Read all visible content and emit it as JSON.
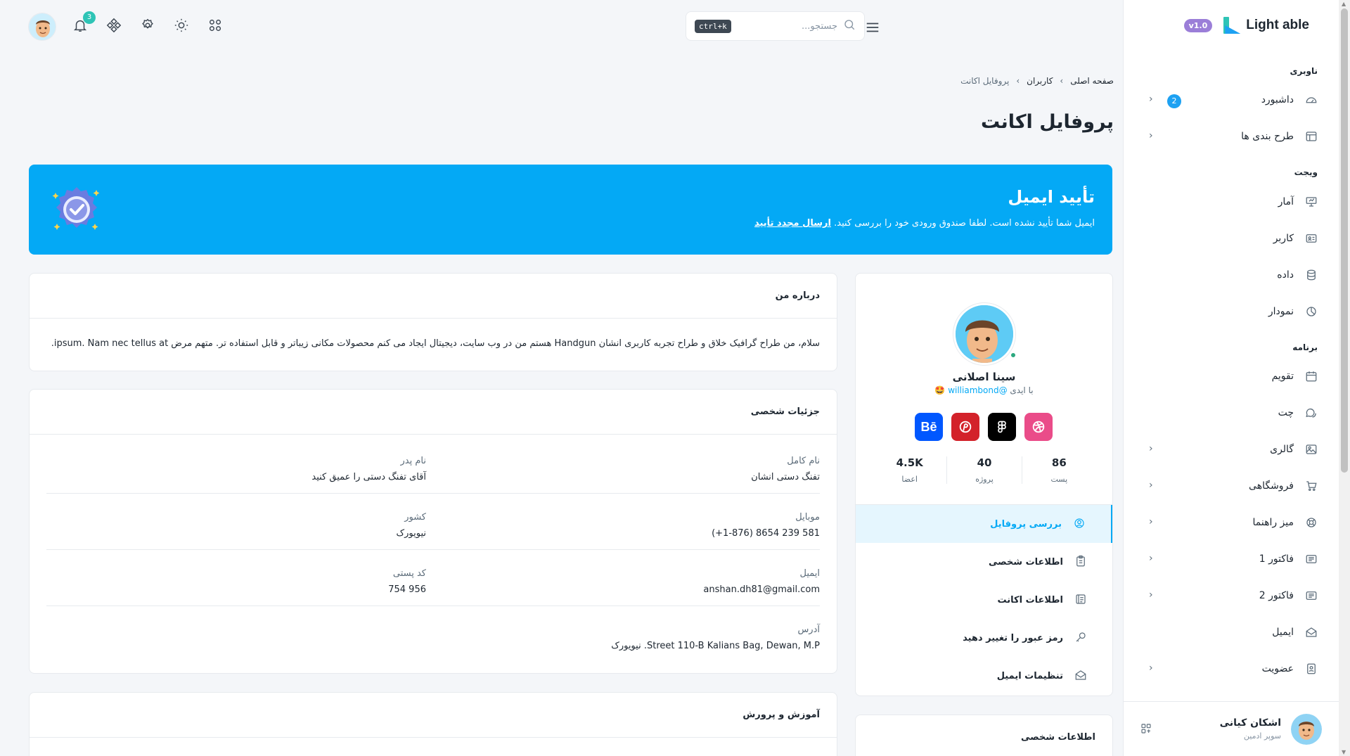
{
  "sidebar": {
    "brand": "Light able",
    "version": "v1.0",
    "sections": {
      "nav": "ناوبری",
      "widget": "ویجت",
      "app": "برنامه"
    },
    "items": [
      {
        "label": "داشبورد",
        "badge": "2",
        "arrow": true
      },
      {
        "label": "طرح بندی ها",
        "arrow": true
      },
      {
        "label": "آمار"
      },
      {
        "label": "کاربر"
      },
      {
        "label": "داده"
      },
      {
        "label": "نمودار"
      },
      {
        "label": "تقویم"
      },
      {
        "label": "چت"
      },
      {
        "label": "گالری",
        "arrow": true
      },
      {
        "label": "فروشگاهی",
        "arrow": true
      },
      {
        "label": "میز راهنما",
        "arrow": true
      },
      {
        "label": "فاکتور 1",
        "arrow": true
      },
      {
        "label": "فاکتور 2",
        "arrow": true
      },
      {
        "label": "ایمیل"
      },
      {
        "label": "عضویت",
        "arrow": true
      }
    ],
    "user": {
      "name": "اشکان کیانی",
      "role": "سوپر ادمین"
    }
  },
  "header": {
    "search_placeholder": "جستجو...",
    "shortcut": "ctrl+k",
    "notification_count": "3"
  },
  "breadcrumb": [
    "صفحه اصلی",
    "کاربران",
    "پروفایل اکانت"
  ],
  "page_title": "پروفایل اکانت",
  "banner": {
    "title": "تأیید ایمیل",
    "text": "ایمیل شما تأیید نشده است. لطفا صندوق ورودی خود را بررسی کنید.",
    "link": "ارسال مجدد تأیید"
  },
  "profile": {
    "name": "سینا اصلانی",
    "handle_prefix": "با ایدی",
    "handle": "@williambond",
    "emoji": "🤩",
    "social": [
      {
        "name": "dribbble",
        "color": "#ea4c89"
      },
      {
        "name": "figma",
        "color": "#000000"
      },
      {
        "name": "pinterest",
        "color": "#d3222a"
      },
      {
        "name": "behance",
        "color": "#0057ff",
        "glyph": "Bē"
      }
    ],
    "stats": [
      {
        "value": "86",
        "label": "پست"
      },
      {
        "value": "40",
        "label": "پروژه"
      },
      {
        "value": "4.5K",
        "label": "اعضا"
      }
    ],
    "menu": [
      {
        "label": "بررسی پروفایل",
        "active": true
      },
      {
        "label": "اطلاعات شخصی"
      },
      {
        "label": "اطلاعات اکانت"
      },
      {
        "label": "رمز عبور را تغییر دهید"
      },
      {
        "label": "تنظیمات ایمیل"
      }
    ],
    "second_card_title": "اطلاعات شخصی"
  },
  "about": {
    "title": "درباره من",
    "text": "سلام، من طراح گرافیک خلاق و طراح تجربه کاربری انشان Handgun هستم من در وب سایت، دیجیتال ایجاد می کنم محصولات مکانی زیباتر و قابل استفاده تر. متهم مرض ipsum. Nam nec tellus at."
  },
  "details": {
    "title": "جزئیات شخصی",
    "rows": [
      [
        {
          "k": "نام کامل",
          "v": "تفنگ دستی انشان"
        },
        {
          "k": "نام پدر",
          "v": "آقای تفنگ دستی را عمیق کنید"
        }
      ],
      [
        {
          "k": "موبایل",
          "v": "(+1-876) 8654 239 581"
        },
        {
          "k": "کشور",
          "v": "نیویورک"
        }
      ],
      [
        {
          "k": "ایمیل",
          "v": "anshan.dh81@gmail.com"
        },
        {
          "k": "کد پستی",
          "v": "956 754"
        }
      ],
      [
        {
          "k": "آدرس",
          "v": "Street 110-B Kalians Bag, Dewan, M.P. نیویورک"
        }
      ]
    ]
  },
  "education": {
    "title": "آموزش و پرورش"
  }
}
